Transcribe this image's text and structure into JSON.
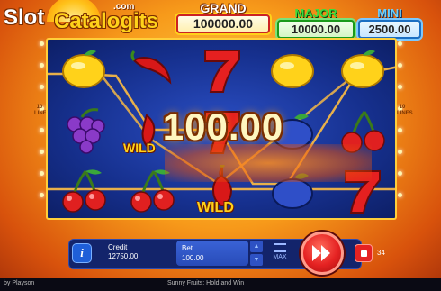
{
  "logo": {
    "part1": "Slot",
    "part2": "Catalogits",
    "com": ".com"
  },
  "jackpots": {
    "grand": {
      "label": "GRAND",
      "value": "100000.00"
    },
    "major": {
      "label": "MAJOR",
      "value": "10000.00"
    },
    "mini": {
      "label": "MINI",
      "value": "2500.00"
    }
  },
  "reels": {
    "lines_label": "10 LINES",
    "win_amount": "100.00",
    "wild_label": "WILD",
    "symbols": [
      [
        "lemon",
        "grapes",
        "cherries"
      ],
      [
        "chili",
        "chili-wild",
        "cherries"
      ],
      [
        "seven",
        "seven",
        "chili-wild"
      ],
      [
        "lemon",
        "plum",
        "plum"
      ],
      [
        "lemon",
        "cherries",
        "seven"
      ]
    ]
  },
  "controls": {
    "info": "i",
    "credit_label": "Credit",
    "credit_value": "12750.00",
    "bet_label": "Bet",
    "bet_value": "100.00",
    "max_label": "MAX",
    "autoplay_count": "34"
  },
  "footer": {
    "by": "by Playson",
    "game_title": "Sunny Fruits: Hold and Win"
  },
  "colors": {
    "reel_bg": "#16308e",
    "frame": "#ffcf3a",
    "spin": "#e52222",
    "win_line": "#e8b04a"
  }
}
